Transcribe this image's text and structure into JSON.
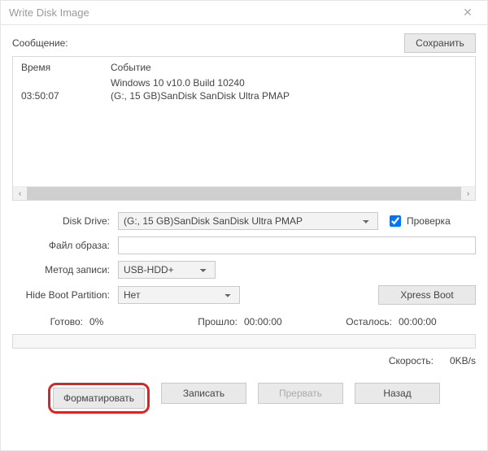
{
  "window": {
    "title": "Write Disk Image"
  },
  "top": {
    "message_label": "Сообщение:",
    "save_button": "Сохранить"
  },
  "log": {
    "col_time": "Время",
    "col_event": "Событие",
    "rows": [
      {
        "time": "",
        "event": "Windows 10 v10.0 Build 10240"
      },
      {
        "time": "03:50:07",
        "event": "(G:, 15 GB)SanDisk SanDisk Ultra  PMAP"
      }
    ],
    "scroll_left": "‹",
    "scroll_right": "›"
  },
  "form": {
    "disk_drive_label": "Disk Drive:",
    "disk_drive_value": "(G:, 15 GB)SanDisk SanDisk Ultra  PMAP",
    "check_label": "Проверка",
    "check_value": true,
    "image_label": "Файл образа:",
    "image_value": "",
    "write_method_label": "Метод записи:",
    "write_method_value": "USB-HDD+",
    "hide_boot_label": "Hide Boot Partition:",
    "hide_boot_value": "Нет",
    "xpress_boot": "Xpress Boot"
  },
  "status": {
    "done_label": "Готово:",
    "done_value": "0%",
    "elapsed_label": "Прошло:",
    "elapsed_value": "00:00:00",
    "remain_label": "Осталось:",
    "remain_value": "00:00:00",
    "speed_label": "Скорость:",
    "speed_value": "0KB/s"
  },
  "actions": {
    "format": "Форматировать",
    "write": "Записать",
    "abort": "Прервать",
    "back": "Назад"
  }
}
